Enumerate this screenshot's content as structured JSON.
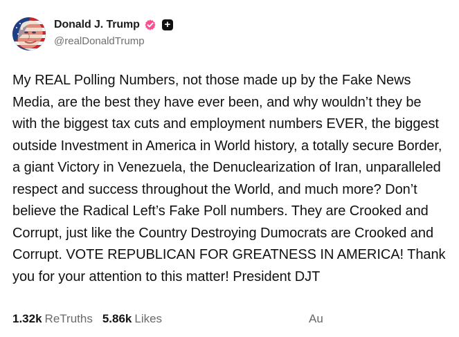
{
  "post": {
    "author": {
      "display_name": "Donald J. Trump",
      "handle": "@realDonaldTrump",
      "avatar_icon": "flag-face-avatar-icon",
      "verified_icon": "verified-check-icon",
      "plus_badge": "+"
    },
    "text": "My REAL Polling Numbers, not those made up by the Fake News Media, are the best they have ever been, and why wouldn’t they be with the biggest tax cuts and employment numbers EVER, the biggest outside Investment in America in World history, a totally secure Border, a giant Victory in Venezuela, the Denuclearization of Iran, unparalleled respect and success throughout the World, and much more? Don’t believe the Radical Left’s Fake Poll numbers. They are Crooked and Corrupt, just like the Country Destroying Dumocrats are Crooked and Corrupt. VOTE REPUBLICAN FOR GREATNESS IN AMERICA! Thank you for your attention to this matter! President DJT",
    "stats": {
      "retruths_count": "1.32k",
      "retruths_label": "ReTruths",
      "likes_count": "5.86k",
      "likes_label": "Likes"
    },
    "date_visible": "Au"
  },
  "colors": {
    "text": "#111111",
    "muted": "#666666",
    "verified": "#ff4f93",
    "plus_badge": "#111111",
    "background": "#ffffff"
  }
}
